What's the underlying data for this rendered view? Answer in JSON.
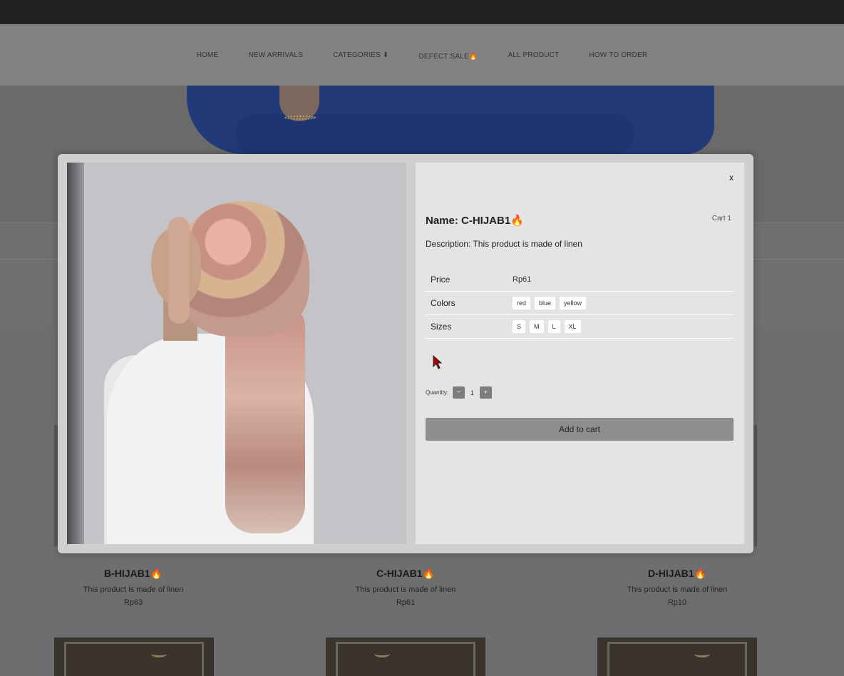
{
  "nav": {
    "items": [
      "HOME",
      "NEW ARRIVALS",
      "CATEGORIES ⬇",
      "DEFECT SALE🔥",
      "ALL PRODUCT",
      "HOW TO ORDER"
    ]
  },
  "modal": {
    "close_label": "x",
    "cart_label": "Cart 1",
    "title": "Name: C-HIJAB1🔥",
    "description": "Description: This product is made of linen",
    "price_label": "Price",
    "price_value": "Rp61",
    "colors_label": "Colors",
    "colors": [
      "red",
      "blue",
      "yellow"
    ],
    "sizes_label": "Sizes",
    "sizes": [
      "S",
      "M",
      "L",
      "XL"
    ],
    "quantity_label": "Quantity:",
    "quantity_minus": "−",
    "quantity_value": "1",
    "quantity_plus": "+",
    "add_to_cart": "Add to cart"
  },
  "products": [
    {
      "name": "B-HIJAB1🔥",
      "description": "This product is made of linen",
      "price": "Rp63"
    },
    {
      "name": "C-HIJAB1🔥",
      "description": "This product is made of linen",
      "price": "Rp61"
    },
    {
      "name": "D-HIJAB1🔥",
      "description": "This product is made of linen",
      "price": "Rp10"
    }
  ]
}
